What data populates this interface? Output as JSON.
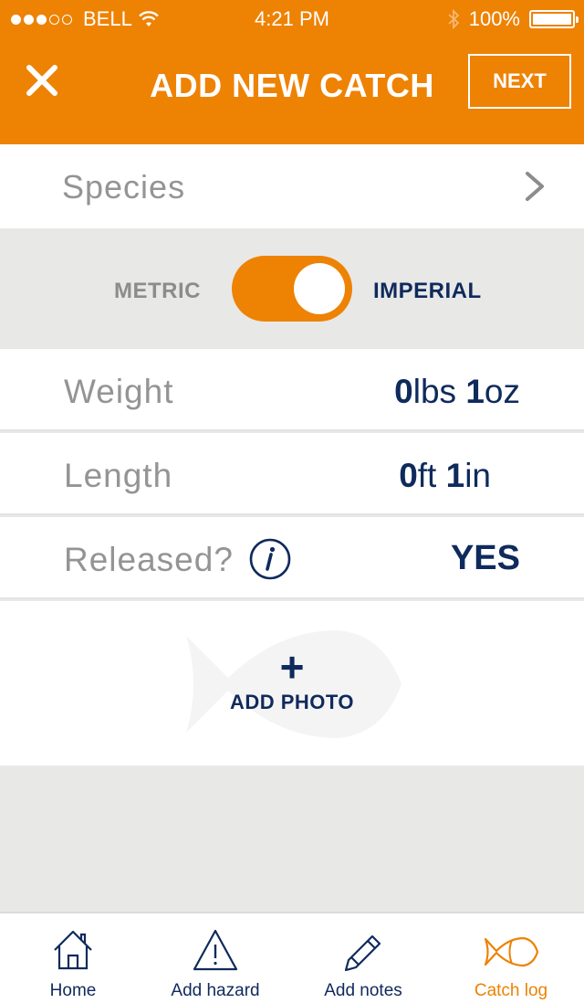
{
  "status_bar": {
    "carrier": "BELL",
    "time": "4:21 PM",
    "battery": "100%",
    "signal_bars_filled": 3,
    "signal_bars_total": 5
  },
  "header": {
    "title": "ADD NEW CATCH",
    "next_label": "NEXT"
  },
  "species": {
    "label": "Species"
  },
  "units": {
    "metric_label": "METRIC",
    "imperial_label": "IMPERIAL",
    "selected": "IMPERIAL"
  },
  "weight": {
    "label": "Weight",
    "major_value": "0",
    "major_unit": "lbs",
    "minor_value": "1",
    "minor_unit": "oz"
  },
  "length": {
    "label": "Length",
    "major_value": "0",
    "major_unit": "ft",
    "minor_value": "1",
    "minor_unit": "in"
  },
  "released": {
    "label": "Released?",
    "value": "YES"
  },
  "photo": {
    "plus": "+",
    "label": "ADD PHOTO"
  },
  "tabbar": {
    "tabs": [
      {
        "label": "Home",
        "icon": "home-icon"
      },
      {
        "label": "Add hazard",
        "icon": "warning-icon"
      },
      {
        "label": "Add notes",
        "icon": "pencil-icon"
      },
      {
        "label": "Catch log",
        "icon": "fish-icon"
      }
    ],
    "active": "Catch log"
  },
  "colors": {
    "accent": "#ee8203",
    "navy": "#0f2a5c",
    "label_gray": "#949494",
    "background_gray": "#e8e8e7"
  }
}
